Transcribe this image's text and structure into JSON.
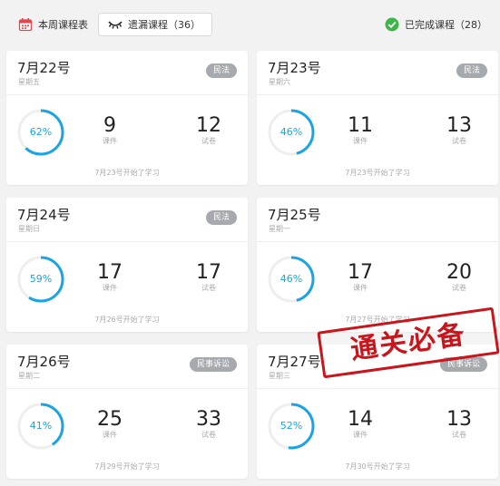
{
  "topbar": {
    "week_schedule": "本周课程表",
    "missed_courses": "遗漏课程（36）",
    "completed_courses": "已完成课程（28）"
  },
  "cards": [
    {
      "date": "7月22号",
      "weekday": "星期五",
      "tag": "民法",
      "progress": "62%",
      "courses": "9",
      "courses_label": "课件",
      "papers": "12",
      "papers_label": "试卷",
      "start_note": "7月23号开始了学习"
    },
    {
      "date": "7月23号",
      "weekday": "星期六",
      "tag": "民法",
      "progress": "46%",
      "courses": "11",
      "courses_label": "课件",
      "papers": "13",
      "papers_label": "试卷",
      "start_note": "7月23号开始了学习"
    },
    {
      "date": "7月24号",
      "weekday": "星期日",
      "tag": "民法",
      "progress": "59%",
      "courses": "17",
      "courses_label": "课件",
      "papers": "17",
      "papers_label": "试卷",
      "start_note": "7月26号开始了学习"
    },
    {
      "date": "7月25号",
      "weekday": "星期一",
      "tag": "",
      "progress": "46%",
      "courses": "17",
      "courses_label": "课件",
      "papers": "20",
      "papers_label": "试卷",
      "start_note": "7月27号开始了学习"
    },
    {
      "date": "7月26号",
      "weekday": "星期二",
      "tag": "民事诉讼",
      "progress": "41%",
      "courses": "25",
      "courses_label": "课件",
      "papers": "33",
      "papers_label": "试卷",
      "start_note": "7月29号开始了学习"
    },
    {
      "date": "7月27号",
      "weekday": "星期三",
      "tag": "民事诉讼",
      "progress": "52%",
      "courses": "14",
      "courses_label": "课件",
      "papers": "13",
      "papers_label": "试卷",
      "start_note": "7月30号开始了学习"
    }
  ],
  "stamp": "通关必备",
  "colors": {
    "accent": "#1ca3e3",
    "stamp": "#c8161d",
    "badge": "#a6a9ad",
    "done": "#3db54a"
  }
}
